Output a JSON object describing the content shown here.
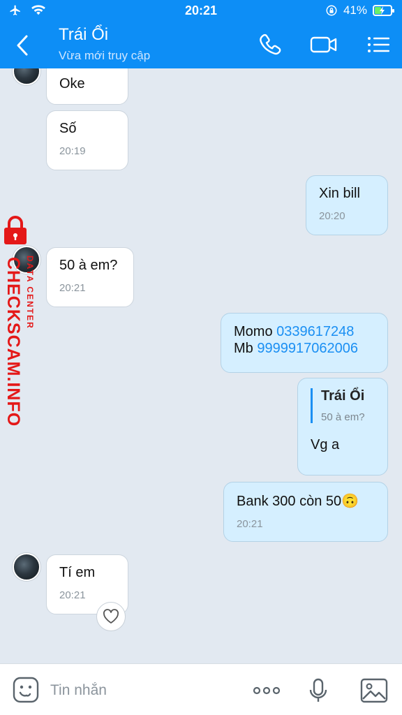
{
  "status": {
    "time": "20:21",
    "battery": "41%",
    "battery_level": 0.41
  },
  "header": {
    "title": "Trái Ổi",
    "subtitle": "Vừa mới truy cập"
  },
  "messages": {
    "m1": {
      "text": "Oke"
    },
    "m2": {
      "text": "Số",
      "time": "20:19"
    },
    "m3": {
      "text": "Xin bill",
      "time": "20:20"
    },
    "m4": {
      "text": "50 à em?",
      "time": "20:21"
    },
    "m5": {
      "line1_label": "Momo ",
      "line1_number": "0339617248",
      "line2_label": "Mb ",
      "line2_number": "9999917062006"
    },
    "m6": {
      "quote_name": "Trái Ổi",
      "quote_text": "50 à em?",
      "text": "Vg a"
    },
    "m7": {
      "text": "Bank 300 còn 50",
      "emoji": "🙃",
      "time": "20:21"
    },
    "m8": {
      "text": "Tí em",
      "time": "20:21"
    }
  },
  "watermark": {
    "brand": "CHECKSCAM.INFO",
    "tagline": "DATA CENTER"
  },
  "input": {
    "placeholder": "Tin nhắn",
    "value": ""
  },
  "colors": {
    "header": "#0d8ef6",
    "chat_bg": "#e2e9f1",
    "outgoing": "#d5efff",
    "link": "#1a8ff3",
    "watermark": "#e41818"
  }
}
